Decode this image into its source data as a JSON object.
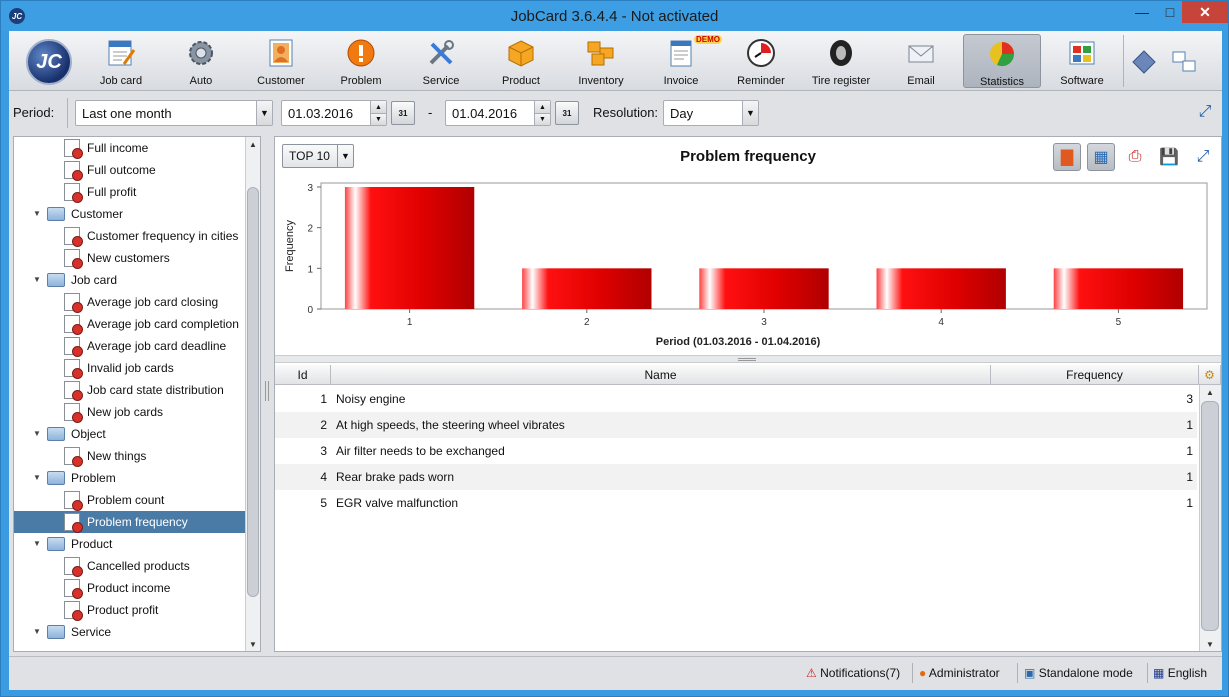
{
  "window": {
    "title": "JobCard 3.6.4.4 - Not activated",
    "app_icon": "JC"
  },
  "toolbar": {
    "logo": "JC",
    "buttons": [
      {
        "label": "Job card",
        "icon": "job-card-icon"
      },
      {
        "label": "Auto",
        "icon": "gear-icon"
      },
      {
        "label": "Customer",
        "icon": "customer-icon"
      },
      {
        "label": "Problem",
        "icon": "warning-icon"
      },
      {
        "label": "Service",
        "icon": "tools-icon"
      },
      {
        "label": "Product",
        "icon": "box-icon"
      },
      {
        "label": "Inventory",
        "icon": "boxes-icon"
      },
      {
        "label": "Invoice",
        "icon": "invoice-icon",
        "badge": "DEMO"
      },
      {
        "label": "Reminder",
        "icon": "clock-icon"
      },
      {
        "label": "Tire register",
        "icon": "tire-icon"
      },
      {
        "label": "Email",
        "icon": "email-icon"
      },
      {
        "label": "Statistics",
        "icon": "pie-chart-icon",
        "active": true
      },
      {
        "label": "Software",
        "icon": "window-grid-icon"
      }
    ]
  },
  "filter": {
    "period_label": "Period:",
    "period_value": "Last one month",
    "date_from": "01.03.2016",
    "date_sep": "-",
    "date_to": "01.04.2016",
    "calendar_label": "31",
    "resolution_label": "Resolution:",
    "resolution_value": "Day"
  },
  "tree": {
    "items": [
      {
        "label": "Full income",
        "kind": "doc"
      },
      {
        "label": "Full outcome",
        "kind": "doc"
      },
      {
        "label": "Full profit",
        "kind": "doc"
      },
      {
        "label": "Customer",
        "kind": "folder"
      },
      {
        "label": "Customer frequency in cities",
        "kind": "doc"
      },
      {
        "label": "New customers",
        "kind": "doc"
      },
      {
        "label": "Job card",
        "kind": "folder"
      },
      {
        "label": "Average job card closing",
        "kind": "doc"
      },
      {
        "label": "Average job card completion",
        "kind": "doc"
      },
      {
        "label": "Average job card deadline",
        "kind": "doc"
      },
      {
        "label": "Invalid job cards",
        "kind": "doc"
      },
      {
        "label": "Job card state distribution",
        "kind": "doc"
      },
      {
        "label": "New job cards",
        "kind": "doc"
      },
      {
        "label": "Object",
        "kind": "folder"
      },
      {
        "label": "New things",
        "kind": "doc"
      },
      {
        "label": "Problem",
        "kind": "folder"
      },
      {
        "label": "Problem count",
        "kind": "doc"
      },
      {
        "label": "Problem frequency",
        "kind": "doc",
        "selected": true
      },
      {
        "label": "Product",
        "kind": "folder"
      },
      {
        "label": "Cancelled products",
        "kind": "doc"
      },
      {
        "label": "Product income",
        "kind": "doc"
      },
      {
        "label": "Product profit",
        "kind": "doc"
      },
      {
        "label": "Service",
        "kind": "folder"
      }
    ]
  },
  "chart_panel": {
    "top_combo": "TOP 10",
    "title": "Problem frequency"
  },
  "chart_data": {
    "type": "bar",
    "title": "Problem frequency",
    "categories": [
      "1",
      "2",
      "3",
      "4",
      "5"
    ],
    "values": [
      3,
      1,
      1,
      1,
      1
    ],
    "xlabel": "Period (01.03.2016 - 01.04.2016)",
    "ylabel": "Frequency",
    "ylim": [
      0,
      3
    ],
    "yticks": [
      "0",
      "1",
      "2",
      "3"
    ],
    "bar_color": "#e00000",
    "grid": false,
    "legend": "none"
  },
  "table": {
    "headers": {
      "id": "Id",
      "name": "Name",
      "freq": "Frequency"
    },
    "rows": [
      {
        "id": "1",
        "name": "Noisy engine",
        "freq": "3"
      },
      {
        "id": "2",
        "name": "At high speeds, the steering wheel vibrates",
        "freq": "1"
      },
      {
        "id": "3",
        "name": "Air filter needs to be exchanged",
        "freq": "1"
      },
      {
        "id": "4",
        "name": "Rear brake pads worn",
        "freq": "1"
      },
      {
        "id": "5",
        "name": "EGR valve malfunction",
        "freq": "1"
      }
    ]
  },
  "status": {
    "notifications": "Notifications(7)",
    "user": "Administrator",
    "mode": "Standalone mode",
    "language": "English"
  }
}
